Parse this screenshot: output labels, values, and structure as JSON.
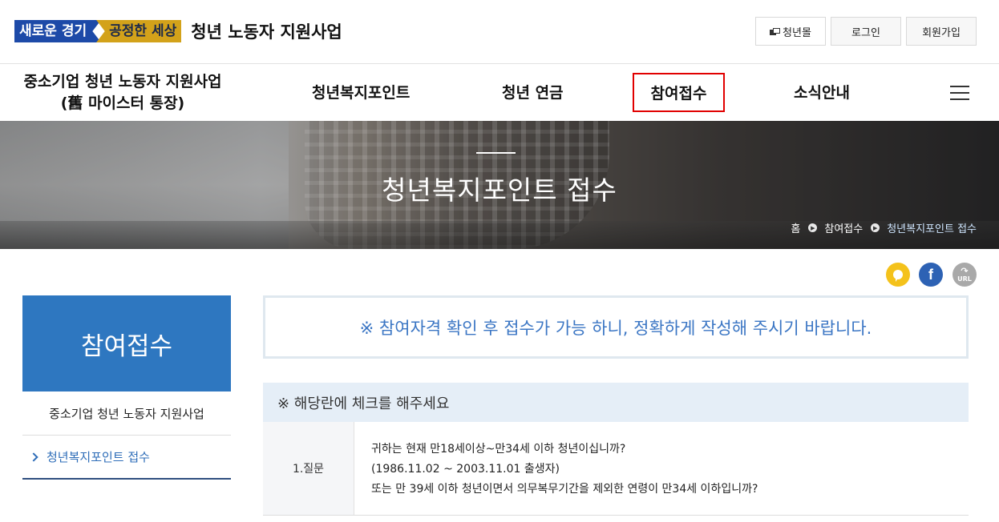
{
  "header": {
    "logo_part1": "새로운 경기",
    "logo_part2": "공정한 세상",
    "title": "청년 노동자 지원사업",
    "buttons": {
      "mall": "청년몰",
      "login": "로그인",
      "join": "회원가입"
    }
  },
  "nav": {
    "site_name_line1": "중소기업 청년 노동자 지원사업",
    "site_name_line2": "(舊 마이스터 통장)",
    "items": [
      {
        "label": "청년복지포인트"
      },
      {
        "label": "청년 연금"
      },
      {
        "label": "참여접수"
      },
      {
        "label": "소식안내"
      }
    ],
    "highlight_color": "#e10000"
  },
  "banner": {
    "title": "청년복지포인트 접수",
    "breadcrumb": [
      "홈",
      "참여접수",
      "청년복지포인트 접수"
    ]
  },
  "share": {
    "facebook": "f",
    "url": "URL"
  },
  "sidebar": {
    "title": "참여접수",
    "subtitle": "중소기업 청년 노동자 지원사업",
    "link": "청년복지포인트 접수"
  },
  "content": {
    "notice": "※ 참여자격 확인 후 접수가 가능 하니, 정확하게 작성해 주시기 바랍니다.",
    "check_header": "※ 해당란에 체크를 해주세요",
    "questions": [
      {
        "label": "1.질문",
        "line1": "귀하는 현재 만18세이상~만34세 이하 청년이십니까?",
        "line2": "(1986.11.02 ~ 2003.11.01 출생자)",
        "line3": "또는 만 39세 이하 청년이면서 의무복무기간을 제외한 연령이 만34세 이하입니까?"
      }
    ]
  },
  "colors": {
    "brand_blue": "#2e77c0",
    "notice_text": "#3b76c4",
    "logo_blue": "#1d4aa8",
    "logo_gold": "#d3a21a"
  }
}
